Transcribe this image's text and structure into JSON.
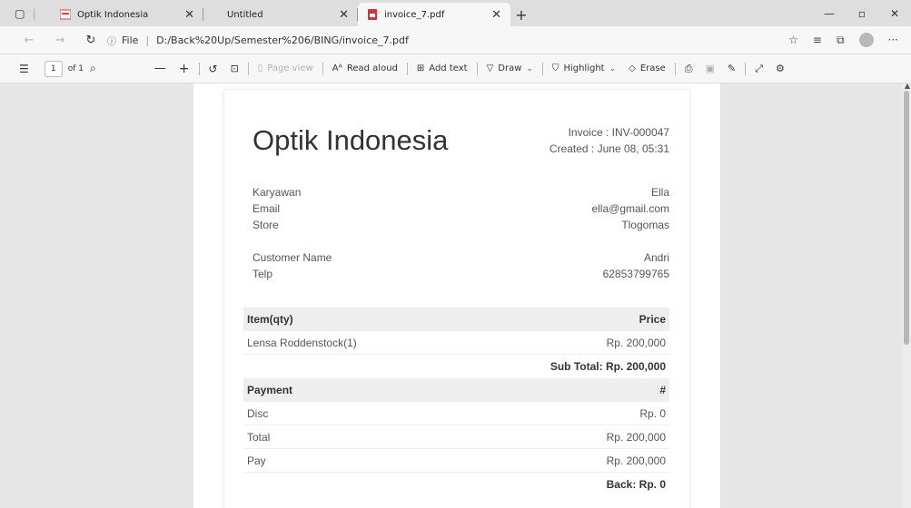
{
  "tabs": [
    {
      "title": "Optik Indonesia",
      "active": false
    },
    {
      "title": "Untitled",
      "active": false
    },
    {
      "title": "invoice_7.pdf",
      "active": true
    }
  ],
  "address": {
    "info_label": "File",
    "url": "D:/Back%20Up/Semester%206/BING/invoice_7.pdf"
  },
  "pdf_toolbar": {
    "page_number": "1",
    "page_total": "of 1",
    "page_view": "Page view",
    "read_aloud": "Read aloud",
    "add_text": "Add text",
    "draw": "Draw",
    "highlight": "Highlight",
    "erase": "Erase"
  },
  "invoice": {
    "company": "Optik Indonesia",
    "invoice_line": "Invoice : INV-000047",
    "created_line": "Created : June 08, 05:31",
    "staff": [
      {
        "label": "Karyawan",
        "value": "Ella"
      },
      {
        "label": "Email",
        "value": "ella@gmail.com"
      },
      {
        "label": "Store",
        "value": "Tlogomas"
      }
    ],
    "customer": [
      {
        "label": "Customer Name",
        "value": "Andri"
      },
      {
        "label": "Telp",
        "value": "62853799765"
      }
    ],
    "items_header": {
      "left": "Item(qty)",
      "right": "Price"
    },
    "items": [
      {
        "name": "Lensa Roddenstock(1)",
        "price": "Rp. 200,000"
      }
    ],
    "subtotal": "Sub Total: Rp. 200,000",
    "payment_header": {
      "left": "Payment",
      "right": "#"
    },
    "payments": [
      {
        "label": "Disc",
        "value": "Rp. 0"
      },
      {
        "label": "Total",
        "value": "Rp. 200,000"
      },
      {
        "label": "Pay",
        "value": "Rp. 200,000"
      }
    ],
    "back": "Back: Rp. 0"
  }
}
